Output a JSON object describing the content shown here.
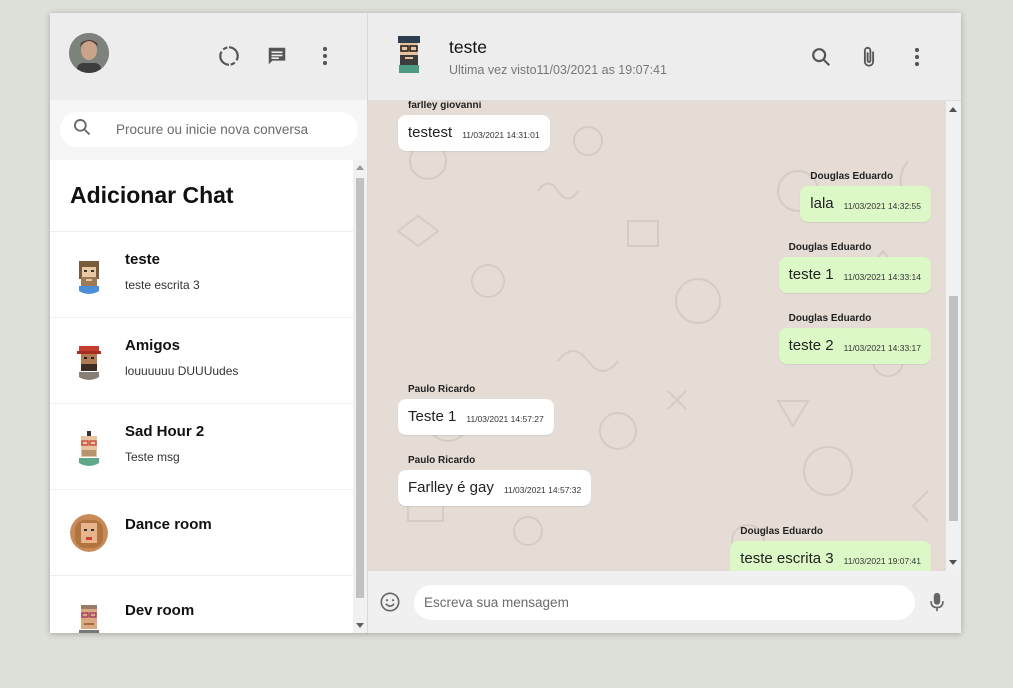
{
  "sidebar": {
    "search_placeholder": "Procure ou inicie nova conversa",
    "add_chat_label": "Adicionar Chat",
    "chats": [
      {
        "name": "teste",
        "last_message": "teste escrita 3",
        "avatar": "bearded-man-avatar"
      },
      {
        "name": "Amigos",
        "last_message": "louuuuuu DUUUudes",
        "avatar": "red-cap-man-avatar"
      },
      {
        "name": "Sad Hour 2",
        "last_message": "Teste msg",
        "avatar": "glasses-man-avatar"
      },
      {
        "name": "Dance room",
        "last_message": "",
        "avatar": "woman-avatar"
      },
      {
        "name": "Dev room",
        "last_message": "",
        "avatar": "glasses-man-avatar"
      }
    ]
  },
  "header": {
    "contact_name": "teste",
    "status": "Ultima vez visto11/03/2021 as 19:07:41"
  },
  "messages": [
    {
      "author": "farlley giovanni",
      "text": "testest",
      "time": "11/03/2021 14:31:01",
      "direction": "in"
    },
    {
      "author": "Douglas Eduardo",
      "text": "lala",
      "time": "11/03/2021 14:32:55",
      "direction": "out"
    },
    {
      "author": "Douglas Eduardo",
      "text": "teste 1",
      "time": "11/03/2021 14:33:14",
      "direction": "out"
    },
    {
      "author": "Douglas Eduardo",
      "text": "teste 2",
      "time": "11/03/2021 14:33:17",
      "direction": "out"
    },
    {
      "author": "Paulo Ricardo",
      "text": "Teste 1",
      "time": "11/03/2021 14:57:27",
      "direction": "in"
    },
    {
      "author": "Paulo Ricardo",
      "text": "Farlley é gay",
      "time": "11/03/2021 14:57:32",
      "direction": "in"
    },
    {
      "author": "Douglas Eduardo",
      "text": "teste escrita 3",
      "time": "11/03/2021 19:07:41",
      "direction": "out"
    }
  ],
  "footer": {
    "input_placeholder": "Escreva sua mensagem"
  },
  "colors": {
    "background": "#dddfd9",
    "header": "#ededed",
    "bubble_in": "#ffffff",
    "bubble_out": "#dcf8c6",
    "chat_bg": "#e5ddd5"
  }
}
